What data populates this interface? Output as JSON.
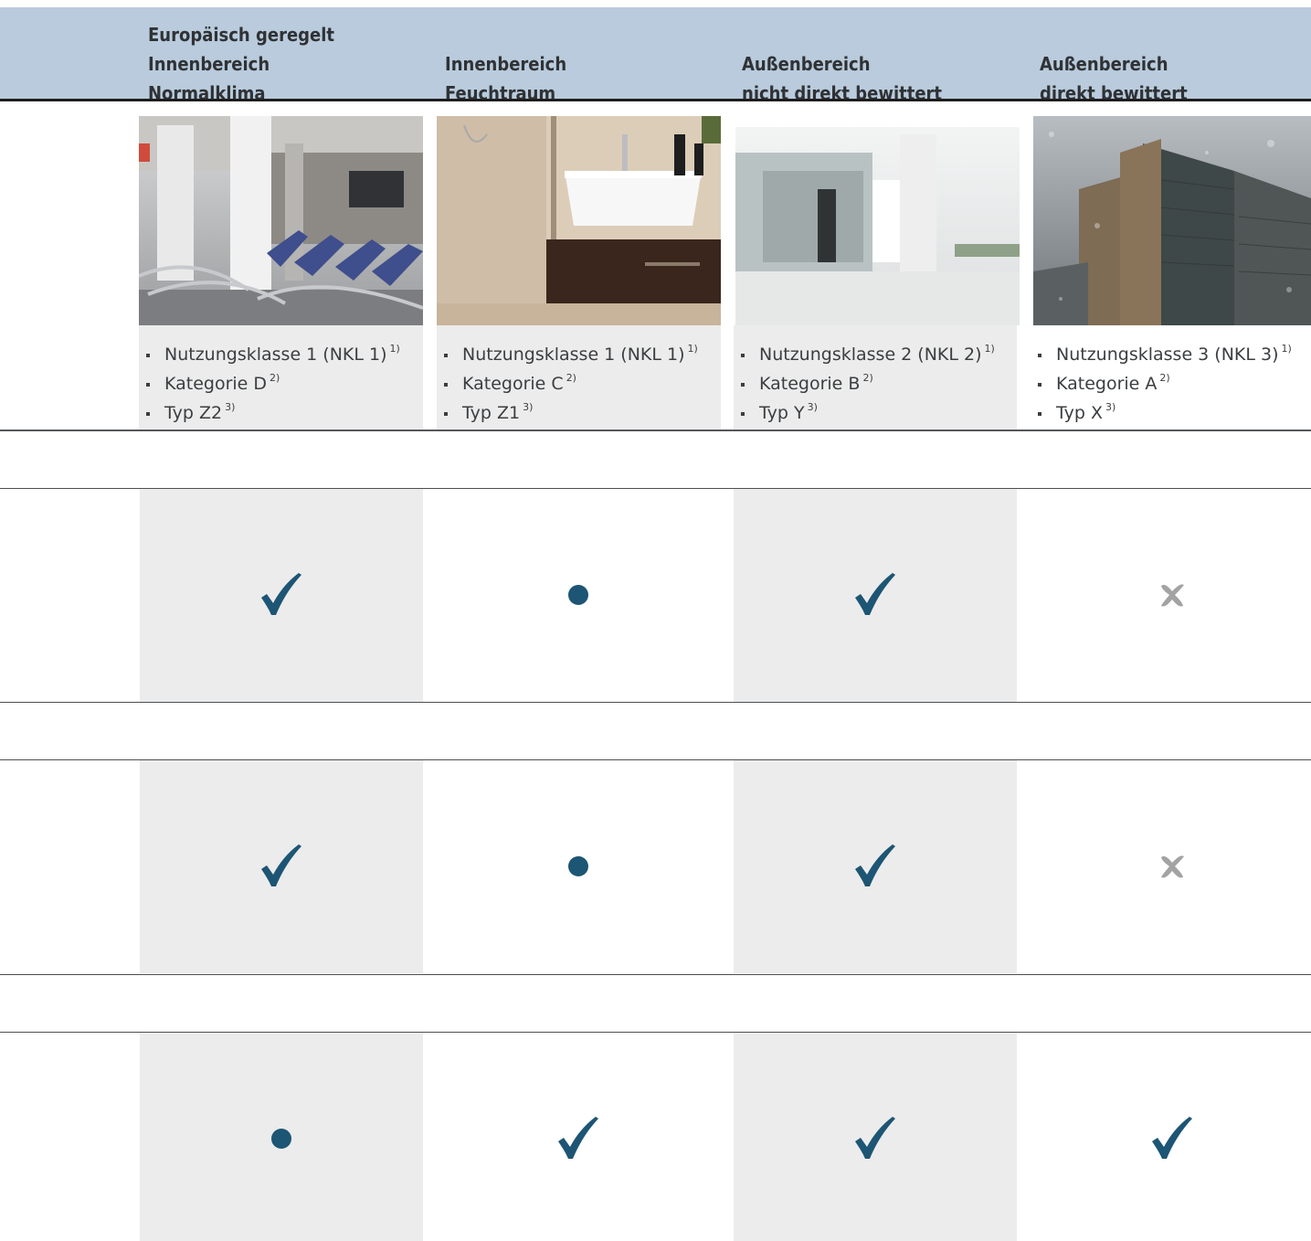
{
  "header": {
    "columns": [
      {
        "lines": [
          "Europäisch geregelt",
          "Innenbereich",
          "Normalklima"
        ]
      },
      {
        "lines": [
          "Innenbereich",
          "Feuchtraum"
        ]
      },
      {
        "lines": [
          "Außenbereich",
          "nicht direkt bewittert"
        ]
      },
      {
        "lines": [
          "Außenbereich",
          "direkt bewittert"
        ]
      }
    ]
  },
  "columns": [
    {
      "image": "waiting-hall-photo",
      "bullets": [
        {
          "text": "Nutzungsklasse 1 (NKL 1)",
          "note": "1)"
        },
        {
          "text": "Kategorie D",
          "note": "2)"
        },
        {
          "text": "Typ Z2",
          "note": "3)"
        }
      ]
    },
    {
      "image": "bathroom-photo",
      "bullets": [
        {
          "text": "Nutzungsklasse 1 (NKL 1)",
          "note": "1)"
        },
        {
          "text": "Kategorie C",
          "note": "2)"
        },
        {
          "text": "Typ Z1",
          "note": "3)"
        }
      ]
    },
    {
      "image": "atrium-photo",
      "bullets": [
        {
          "text": "Nutzungsklasse 2 (NKL 2)",
          "note": "1)"
        },
        {
          "text": "Kategorie B",
          "note": "2)"
        },
        {
          "text": "Typ Y",
          "note": "3)"
        }
      ]
    },
    {
      "image": "building-in-rain-photo",
      "bullets": [
        {
          "text": "Nutzungsklasse 3 (NKL 3)",
          "note": "1)"
        },
        {
          "text": "Kategorie A",
          "note": "2)"
        },
        {
          "text": "Typ X",
          "note": "3)"
        }
      ]
    }
  ],
  "matrix": [
    [
      "check",
      "dot",
      "check",
      "cross"
    ],
    [
      "check",
      "dot",
      "check",
      "cross"
    ],
    [
      "dot",
      "check",
      "check",
      "check"
    ]
  ],
  "colors": {
    "header_band": "#b9cbdc",
    "mark_blue": "#1d5574",
    "mark_gray": "#a3a3a3",
    "cell_shade": "#ececec"
  }
}
